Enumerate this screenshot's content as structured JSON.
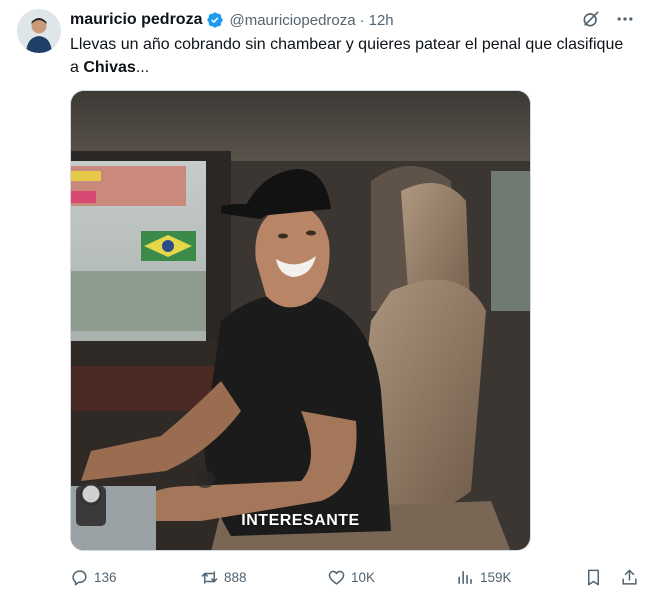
{
  "author": {
    "name": "mauricio pedroza",
    "handle": "@mauriciopedroza",
    "separator": "·",
    "time": "12h"
  },
  "tweet": {
    "text_prefix": "Llevas un año cobrando sin chambear y quieres patear el penal que clasifique a ",
    "text_bold": "Chivas",
    "text_suffix": "..."
  },
  "media": {
    "caption": "INTERESANTE"
  },
  "actions": {
    "replies": "136",
    "reposts": "888",
    "likes": "10K",
    "views": "159K"
  },
  "icons": {
    "verified": "verified-badge-icon",
    "grok": "grok-icon",
    "more": "more-icon",
    "reply": "reply-icon",
    "repost": "repost-icon",
    "like": "like-icon",
    "views": "views-icon",
    "bookmark": "bookmark-icon",
    "share": "share-icon"
  },
  "colors": {
    "text": "#0f1419",
    "secondary": "#536471",
    "verified": "#1d9bf0"
  }
}
